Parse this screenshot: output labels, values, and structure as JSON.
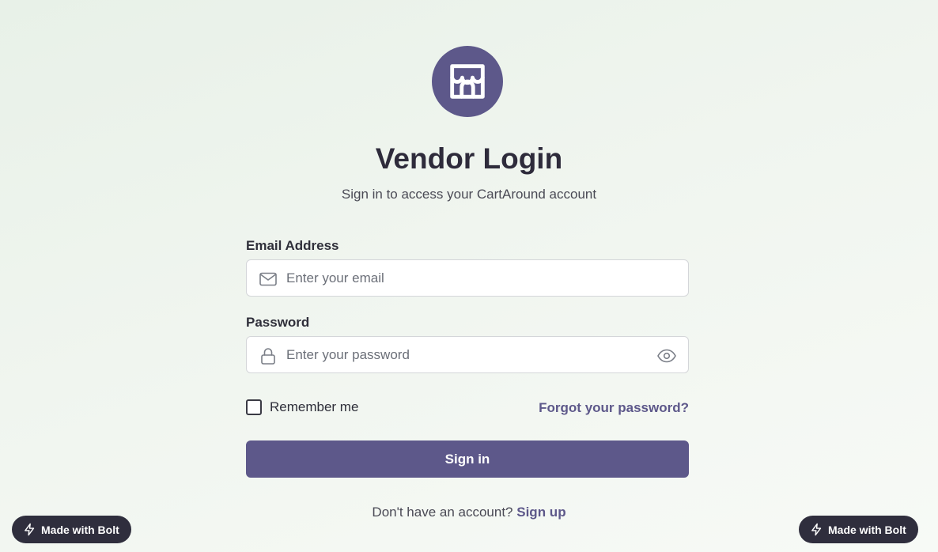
{
  "header": {
    "logo_icon": "storefront-icon",
    "title": "Vendor Login",
    "subtitle": "Sign in to access your CartAround account"
  },
  "form": {
    "email": {
      "label": "Email Address",
      "value": "",
      "placeholder": "Enter your email",
      "icon": "mail-icon"
    },
    "password": {
      "label": "Password",
      "value": "",
      "placeholder": "Enter your password",
      "icon": "lock-icon",
      "toggle_icon": "eye-icon"
    },
    "remember": {
      "label": "Remember me",
      "checked": false
    },
    "forgot_label": "Forgot your password?",
    "submit_label": "Sign in"
  },
  "footer": {
    "prompt": "Don't have an account?",
    "signup_label": "Sign up"
  },
  "badges": {
    "left_label": "Made with Bolt",
    "right_label": "Made with Bolt",
    "icon": "lightning-icon"
  },
  "colors": {
    "accent": "#5d588a",
    "badge_bg": "#2f2e3d",
    "title": "#2e2b3b"
  }
}
